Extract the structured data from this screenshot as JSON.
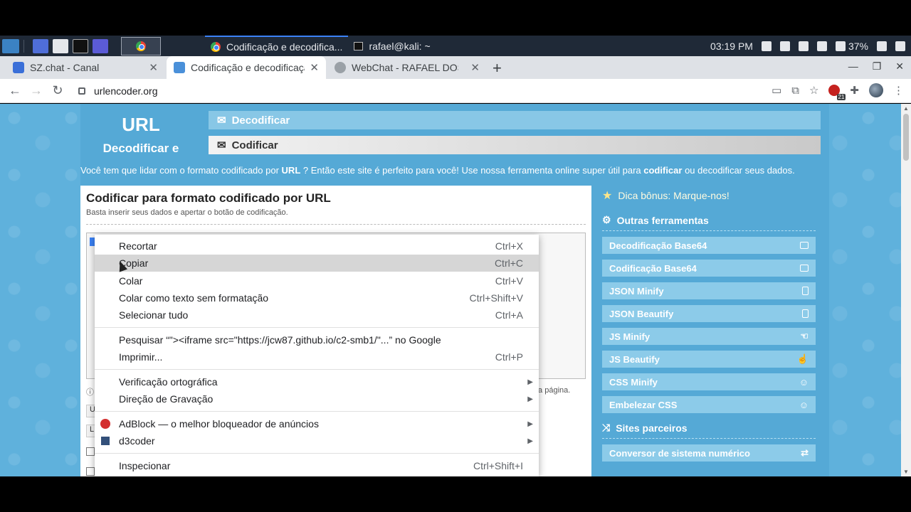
{
  "taskbar": {
    "tasks": [
      {
        "label": "Codificação e decodifica..."
      },
      {
        "label": "rafael@kali: ~"
      }
    ],
    "time": "03:19 PM",
    "battery": "37%"
  },
  "tabs": [
    {
      "title": "SZ.chat - Canal",
      "favicon_color": "#3a6fd8"
    },
    {
      "title": "Codificação e decodificaçã",
      "favicon_color": "#4a90d9"
    },
    {
      "title": "WebChat - RAFAEL DOS",
      "favicon_color": "#9aa0a6"
    }
  ],
  "address": {
    "url": "urlencoder.org"
  },
  "extension_badge": "21",
  "site": {
    "logo_line1": "URL",
    "logo_line2": "Decodificar e",
    "nav_decode": "Decodificar",
    "nav_encode": "Codificar",
    "intro_prefix": "Você tem que lidar com o formato codificado por ",
    "intro_url": "URL",
    "intro_middle": " ? Então este site é perfeito para você! Use nossa ferramenta online super útil para ",
    "intro_encode": "codificar",
    "intro_suffix": " ou decodificar seus dados.",
    "card_title": "Codificar para formato codificado por URL",
    "card_subtitle": "Basta inserir seus dados e apertar o botão de codificação.",
    "info_tail": "ta página.",
    "ctrl_a": "U",
    "ctrl_b": "L"
  },
  "sidebar": {
    "hint": "Dica bônus: Marque-nos!",
    "tools_heading": "Outras ferramentas",
    "tools": [
      "Decodificação Base64",
      "Codificação Base64",
      "JSON Minify",
      "JSON Beautify",
      "JS Minify",
      "JS Beautify",
      "CSS Minify",
      "Embelezar CSS"
    ],
    "partners_heading": "Sites parceiros",
    "partners": [
      "Conversor de sistema numérico"
    ]
  },
  "context_menu": {
    "items": [
      {
        "label": "Recortar",
        "shortcut": "Ctrl+X"
      },
      {
        "label": "Copiar",
        "shortcut": "Ctrl+C"
      },
      {
        "label": "Colar",
        "shortcut": "Ctrl+V"
      },
      {
        "label": "Colar como texto sem formatação",
        "shortcut": "Ctrl+Shift+V"
      },
      {
        "label": "Selecionar tudo",
        "shortcut": "Ctrl+A"
      },
      {
        "label": "Pesquisar “\"><iframe src=\"https://jcw87.github.io/c2-smb1/\"...” no Google",
        "shortcut": ""
      },
      {
        "label": "Imprimir...",
        "shortcut": "Ctrl+P"
      },
      {
        "label": "Verificação ortográfica",
        "shortcut": ""
      },
      {
        "label": "Direção de Gravação",
        "shortcut": ""
      },
      {
        "label": "AdBlock — o melhor bloqueador de anúncios",
        "shortcut": ""
      },
      {
        "label": "d3coder",
        "shortcut": ""
      },
      {
        "label": "Inspecionar",
        "shortcut": "Ctrl+Shift+I"
      }
    ]
  }
}
